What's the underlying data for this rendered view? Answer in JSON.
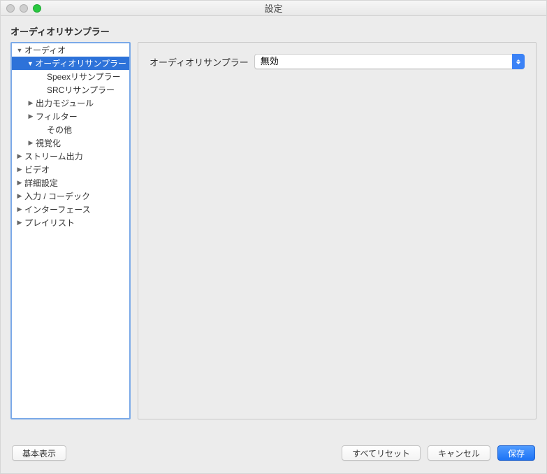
{
  "window": {
    "title": "設定"
  },
  "section": {
    "title": "オーディオリサンプラー"
  },
  "tree": [
    {
      "label": "オーディオ",
      "depth": 0,
      "arrow": "down",
      "selected": false
    },
    {
      "label": "オーディオリサンプラー",
      "depth": 1,
      "arrow": "down",
      "selected": true
    },
    {
      "label": "Speexリサンプラー",
      "depth": 2,
      "arrow": "",
      "selected": false
    },
    {
      "label": "SRCリサンプラー",
      "depth": 2,
      "arrow": "",
      "selected": false
    },
    {
      "label": "出力モジュール",
      "depth": 1,
      "arrow": "right",
      "selected": false
    },
    {
      "label": "フィルター",
      "depth": 1,
      "arrow": "right",
      "selected": false
    },
    {
      "label": "その他",
      "depth": 2,
      "arrow": "",
      "selected": false
    },
    {
      "label": "視覚化",
      "depth": 1,
      "arrow": "right",
      "selected": false
    },
    {
      "label": "ストリーム出力",
      "depth": 0,
      "arrow": "right",
      "selected": false
    },
    {
      "label": "ビデオ",
      "depth": 0,
      "arrow": "right",
      "selected": false
    },
    {
      "label": "詳細設定",
      "depth": 0,
      "arrow": "right",
      "selected": false
    },
    {
      "label": "入力 / コーデック",
      "depth": 0,
      "arrow": "right",
      "selected": false
    },
    {
      "label": "インターフェース",
      "depth": 0,
      "arrow": "right",
      "selected": false
    },
    {
      "label": "プレイリスト",
      "depth": 0,
      "arrow": "right",
      "selected": false
    }
  ],
  "form": {
    "resampler_label": "オーディオリサンプラー",
    "resampler_value": "無効"
  },
  "buttons": {
    "basic_view": "基本表示",
    "reset_all": "すべてリセット",
    "cancel": "キャンセル",
    "save": "保存"
  }
}
